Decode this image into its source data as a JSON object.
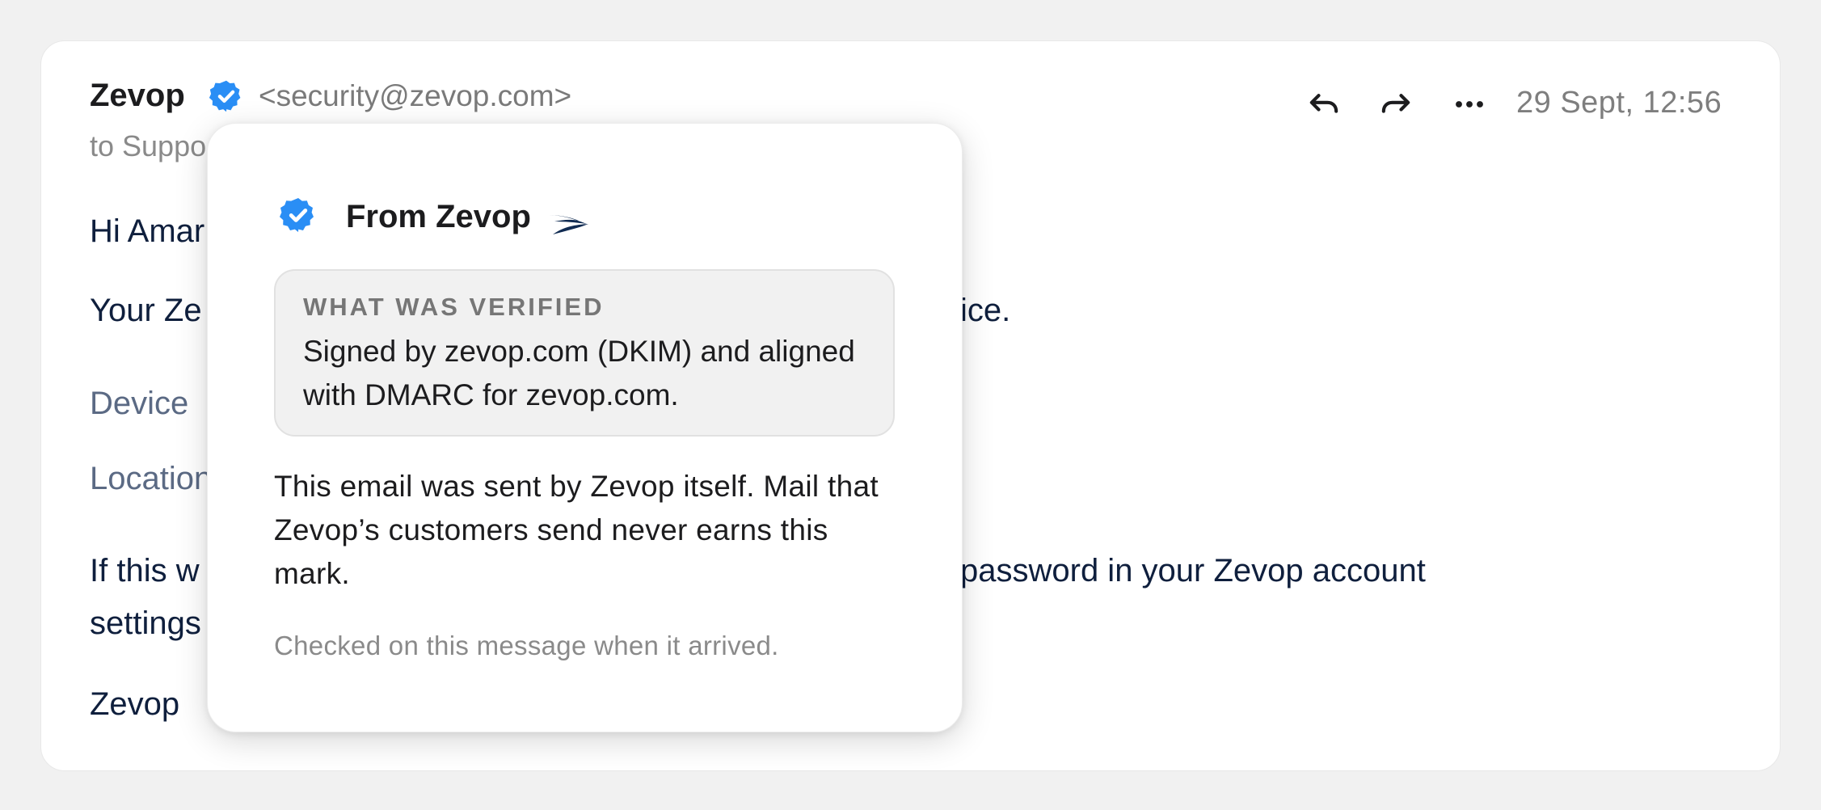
{
  "colors": {
    "badge_blue": "#2a8ef5",
    "body_text": "#0f1f3d",
    "muted_text": "#7a7a7a"
  },
  "email": {
    "sender_name": "Zevop",
    "sender_badge_icon": "verified-badge-icon",
    "sender_email": "<security@zevop.com>",
    "recipient_visible": "to Suppo",
    "date": "29 Sept, 12:56",
    "actions": [
      {
        "name": "reply",
        "icon": "reply-arrow-icon"
      },
      {
        "name": "forward",
        "icon": "forward-arrow-icon"
      },
      {
        "name": "more",
        "icon": "ellipsis-icon"
      }
    ],
    "greeting_visible": "Hi Amar",
    "line1_left_visible": "Your Ze",
    "line1_right_visible": "ice.",
    "device_label_visible": "Device",
    "location_label_visible": "Location",
    "paragraph_line1_left_visible": "If this w",
    "paragraph_line1_right_visible": "password in your Zevop account",
    "paragraph_line2_visible": "settings",
    "signature": "Zevop"
  },
  "popover": {
    "badge_icon": "verified-badge-icon",
    "title": "From Zevop",
    "logo_icon": "zevop-logo-icon",
    "verified_heading": "WHAT WAS VERIFIED",
    "verified_detail": "Signed by zevop.com (DKIM) and aligned with DMARC for zevop.com.",
    "description": "This email was sent by Zevop itself. Mail that Zevop’s customers send never earns this mark.",
    "footnote": "Checked on this message when it arrived."
  }
}
